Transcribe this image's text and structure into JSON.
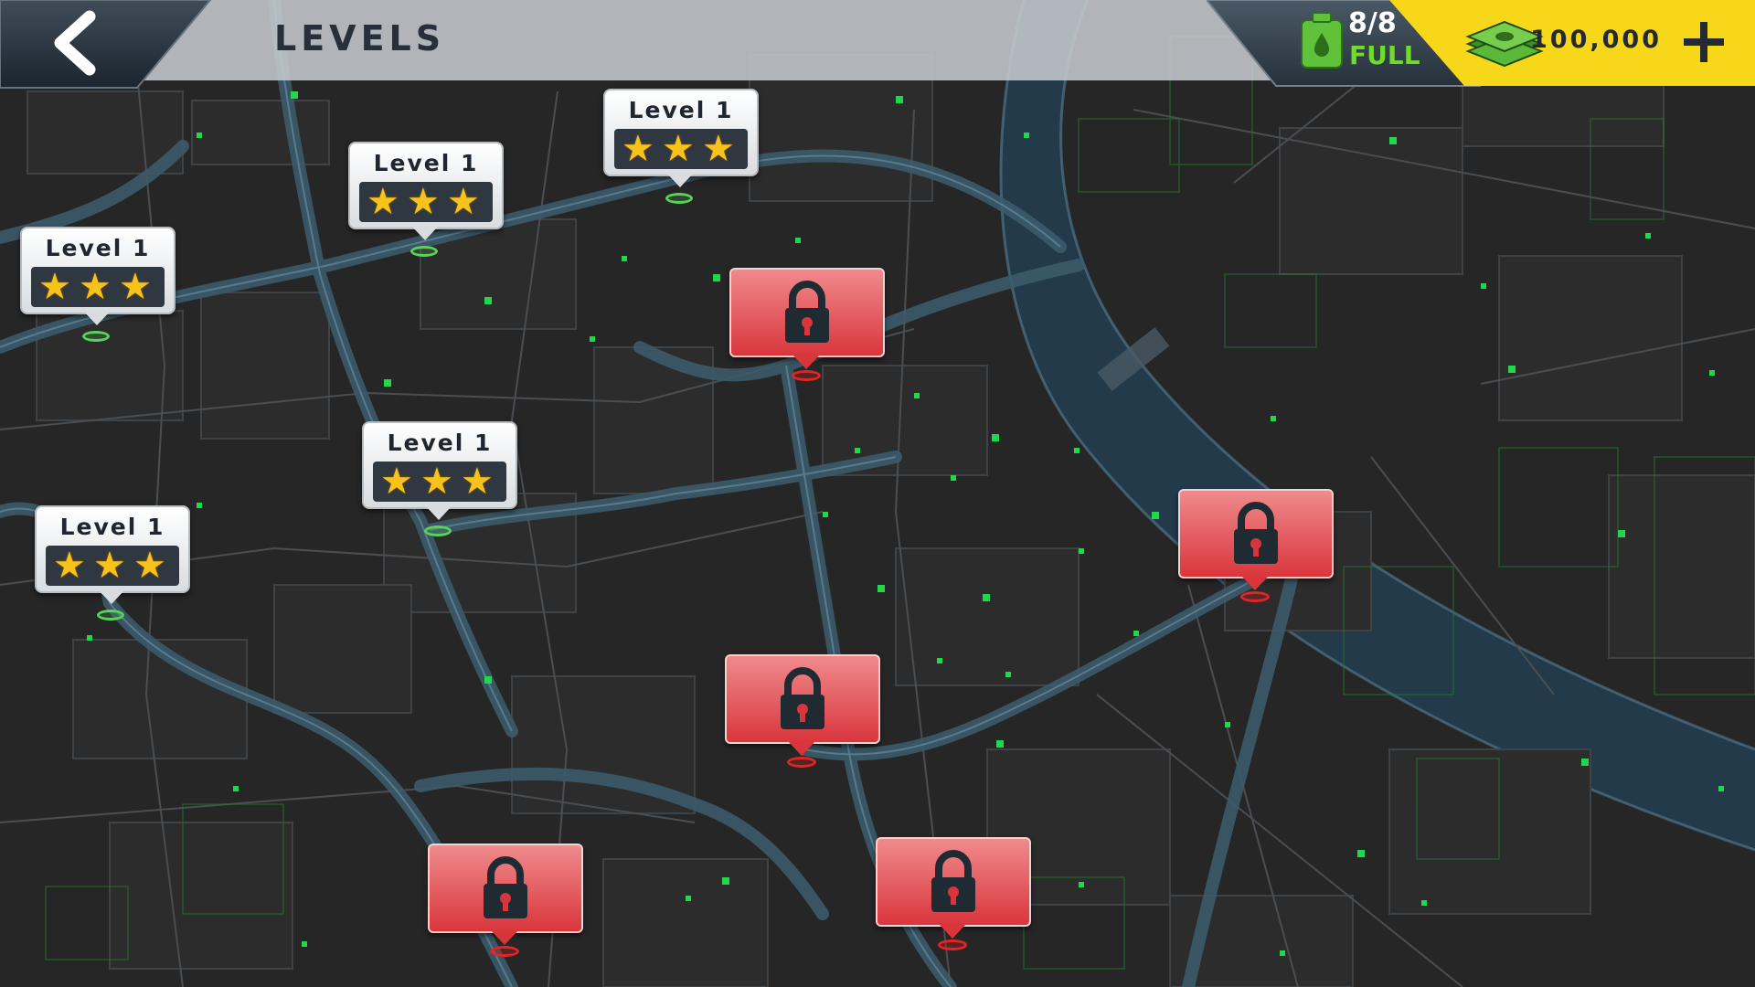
{
  "header": {
    "title": "LEVELS"
  },
  "resources": {
    "fuel_count": "8/8",
    "fuel_status": "FULL",
    "cash_amount": "100,000"
  },
  "colors": {
    "map_background": "#262626",
    "road": "#3c5b6b",
    "river": "#223a4a",
    "data_dot": "#20d94a",
    "cash_bar": "#f6d71a",
    "locked_pin": "#e0454a",
    "unlocked_ring": "#58d25a",
    "locked_ring": "#e32424",
    "star": "#f7c31a"
  },
  "icons": {
    "back": "chevron-left-icon",
    "fuel": "fuel-can-icon",
    "cash": "cash-stack-icon",
    "add": "plus-icon",
    "star": "star-icon",
    "lock": "padlock-icon"
  },
  "levels": [
    {
      "label": "Level 1",
      "stars": 3,
      "locked": false
    },
    {
      "label": "Level 1",
      "stars": 3,
      "locked": false
    },
    {
      "label": "Level 1",
      "stars": 3,
      "locked": false
    },
    {
      "label": "Level 1",
      "stars": 3,
      "locked": false
    },
    {
      "label": "Level 1",
      "stars": 3,
      "locked": false
    },
    {
      "locked": true
    },
    {
      "locked": true
    },
    {
      "locked": true
    },
    {
      "locked": true
    },
    {
      "locked": true
    }
  ]
}
